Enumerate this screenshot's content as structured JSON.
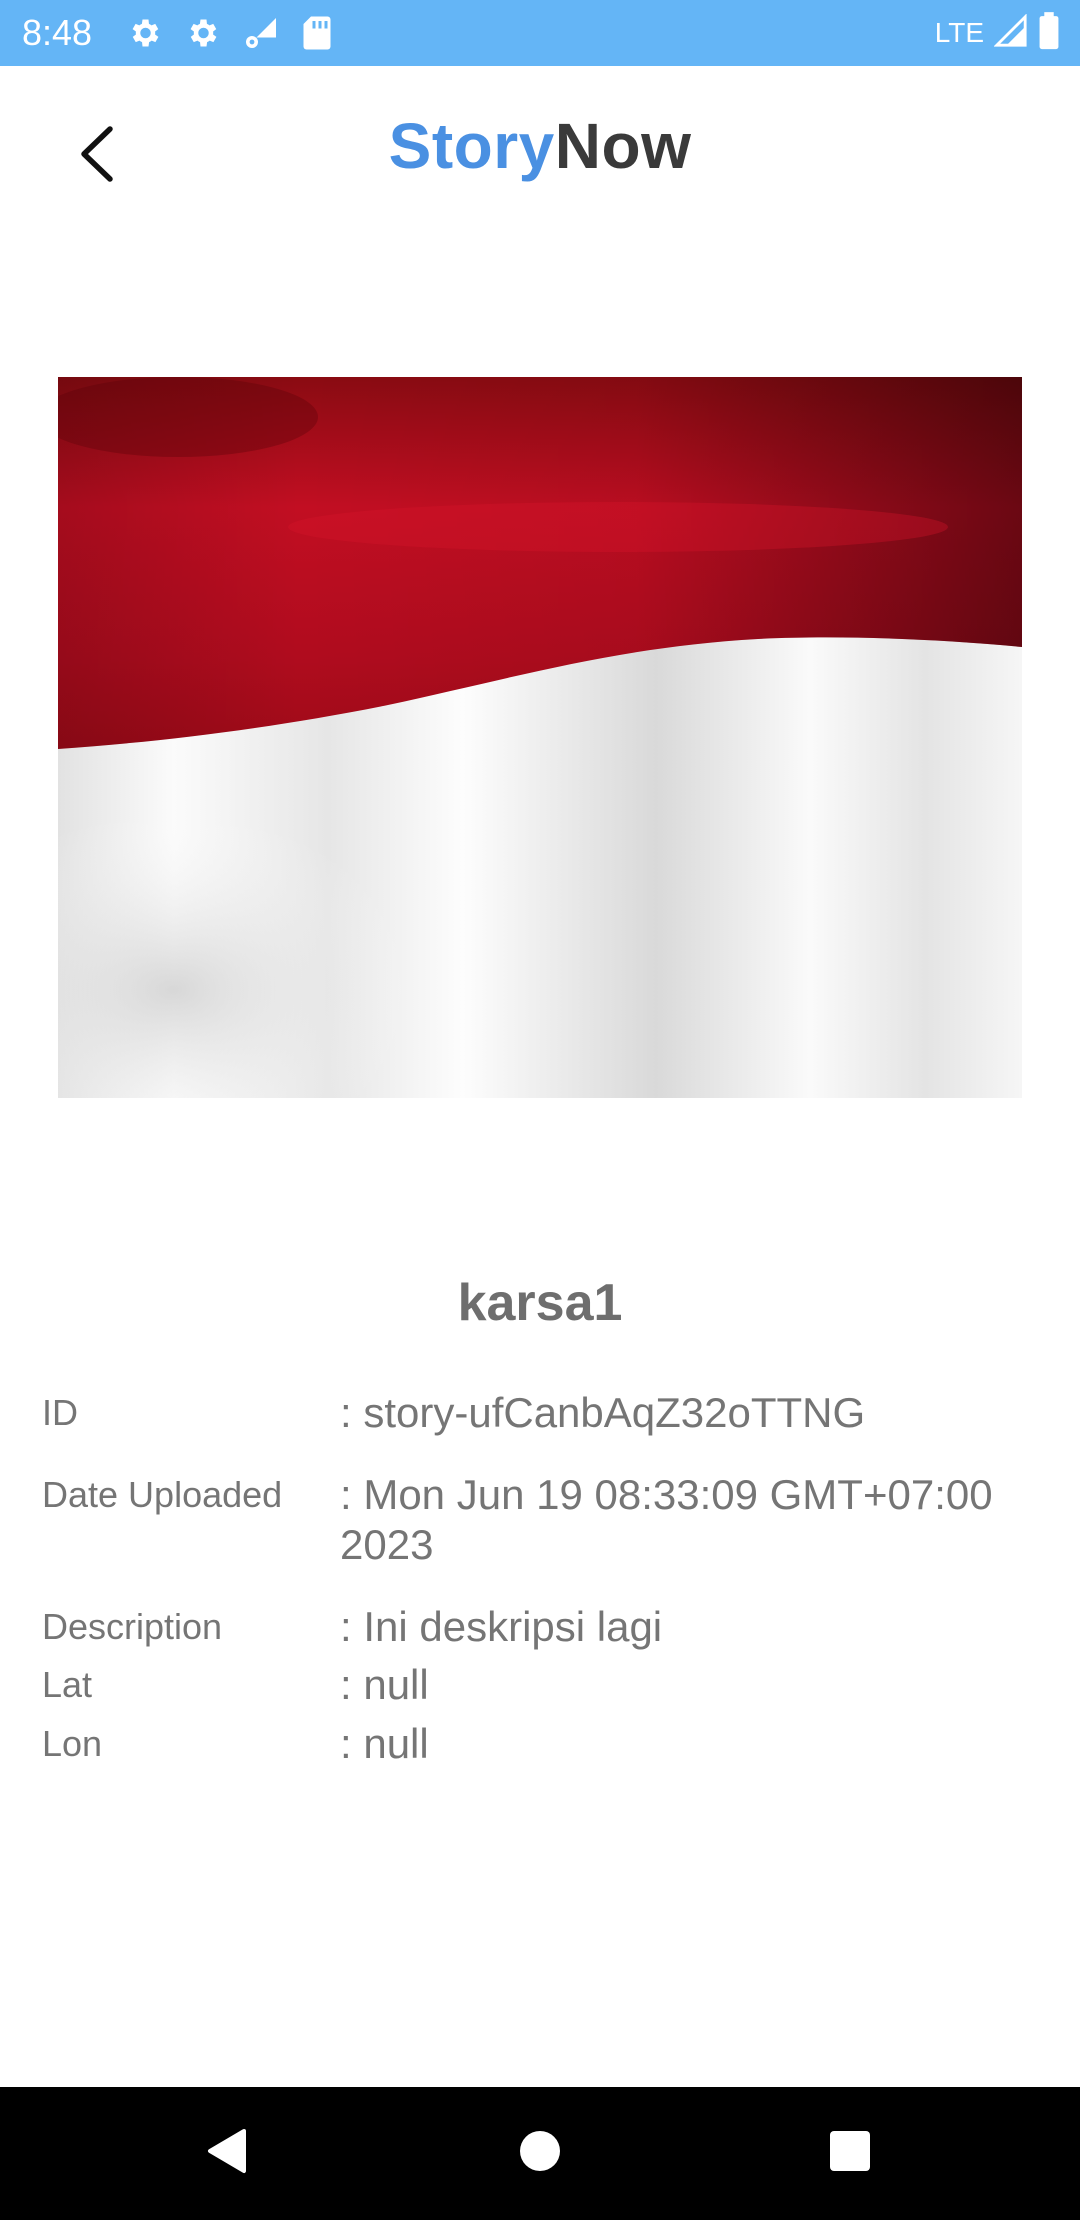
{
  "status_bar": {
    "time": "8:48",
    "network": "LTE",
    "icons": [
      "settings-gear-icon",
      "settings-gear-icon",
      "network-activity-icon",
      "sd-card-icon",
      "signal-icon",
      "battery-icon"
    ]
  },
  "app_bar": {
    "title_part1": "Story",
    "title_part2": "Now",
    "title_part1_color": "#4a90e2",
    "title_part2_color": "#3a3a3a",
    "back_icon": "back-arrow-icon"
  },
  "story": {
    "image_description_icon": "flag-image",
    "author": "karsa1",
    "fields": [
      {
        "label": "ID",
        "value": ": story-ufCanbAqZ32oTTNG"
      },
      {
        "label": "Date Uploaded",
        "value": ": Mon Jun 19 08:33:09 GMT+07:00 2023"
      },
      {
        "label": "Description",
        "value": ": Ini deskripsi lagi"
      },
      {
        "label": "Lat",
        "value": ": null"
      },
      {
        "label": "Lon",
        "value": ": null"
      }
    ]
  },
  "nav_bar": {
    "icons": [
      "nav-back-icon",
      "nav-home-icon",
      "nav-recents-icon"
    ]
  }
}
